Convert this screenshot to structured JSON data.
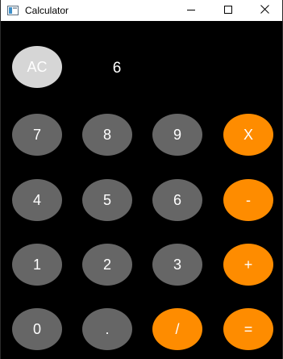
{
  "window": {
    "title": "Calculator"
  },
  "display": {
    "value": "6"
  },
  "keys": {
    "clear": "AC",
    "seven": "7",
    "eight": "8",
    "nine": "9",
    "multiply": "X",
    "four": "4",
    "five": "5",
    "six": "6",
    "subtract": "-",
    "one": "1",
    "two": "2",
    "three": "3",
    "add": "+",
    "zero": "0",
    "decimal": ".",
    "divide": "/",
    "equals": "="
  },
  "colors": {
    "background": "#000000",
    "digit_key": "#666666",
    "clear_key": "#d6d6d6",
    "operator_key": "#fe8c00",
    "text": "#ffffff"
  },
  "icons": {
    "app": "calculator-app-icon",
    "minimize": "minimize-icon",
    "maximize": "maximize-icon",
    "close": "close-icon"
  }
}
